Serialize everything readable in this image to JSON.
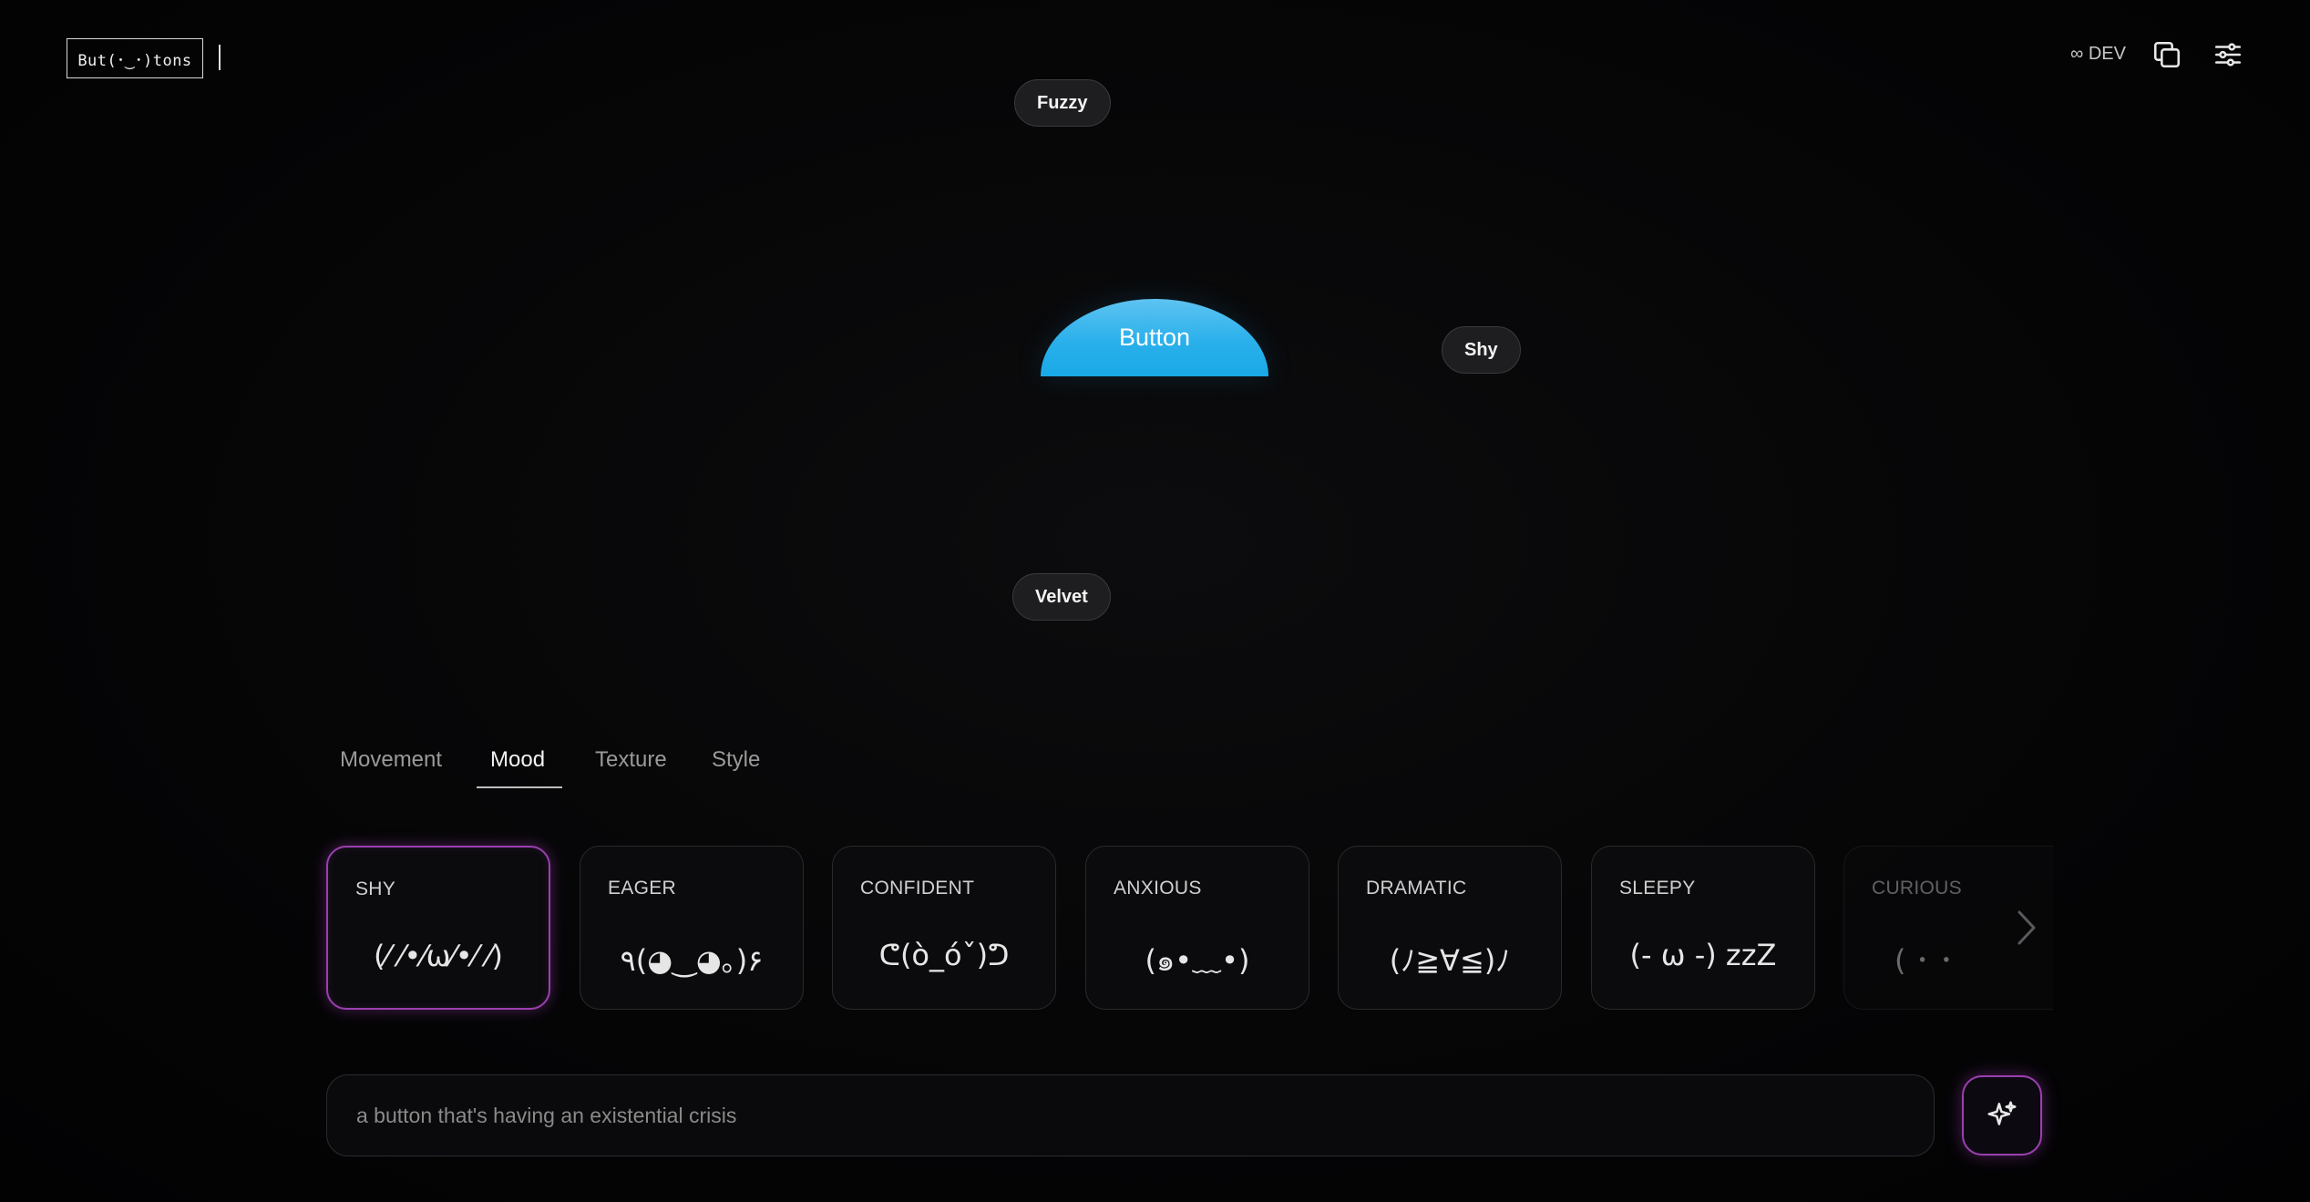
{
  "header": {
    "logo_text": "But(･‿･)tons",
    "dev_label": "∞ DEV",
    "icons": [
      "copy-icon",
      "sliders-icon"
    ]
  },
  "preview": {
    "main_button_label": "Button",
    "chips": {
      "top": "Fuzzy",
      "right": "Shy",
      "bottom": "Velvet"
    },
    "accent_color": "#2ab0eb"
  },
  "tabs": [
    {
      "label": "Movement",
      "active": false
    },
    {
      "label": "Mood",
      "active": true
    },
    {
      "label": "Texture",
      "active": false
    },
    {
      "label": "Style",
      "active": false
    }
  ],
  "mood_cards": [
    {
      "label": "SHY",
      "face": "(⁄ ⁄•⁄ω⁄•⁄ ⁄)",
      "selected": true
    },
    {
      "label": "EAGER",
      "face": "٩(◕‿◕｡)۶",
      "selected": false
    },
    {
      "label": "CONFIDENT",
      "face": "ᕦ(ò_óˇ)ᕤ",
      "selected": false
    },
    {
      "label": "ANXIOUS",
      "face": "(๑•﹏•)",
      "selected": false
    },
    {
      "label": "DRAMATIC",
      "face": "(ﾉ≧∀≦)ﾉ",
      "selected": false
    },
    {
      "label": "SLEEPY",
      "face": "(- ω -) zzZ",
      "selected": false
    },
    {
      "label": "CURIOUS",
      "face": "( ･ ･",
      "selected": false
    }
  ],
  "prompt": {
    "placeholder": "a button that's having an existential crisis",
    "value": ""
  },
  "selection_color": "#9b3fb0"
}
